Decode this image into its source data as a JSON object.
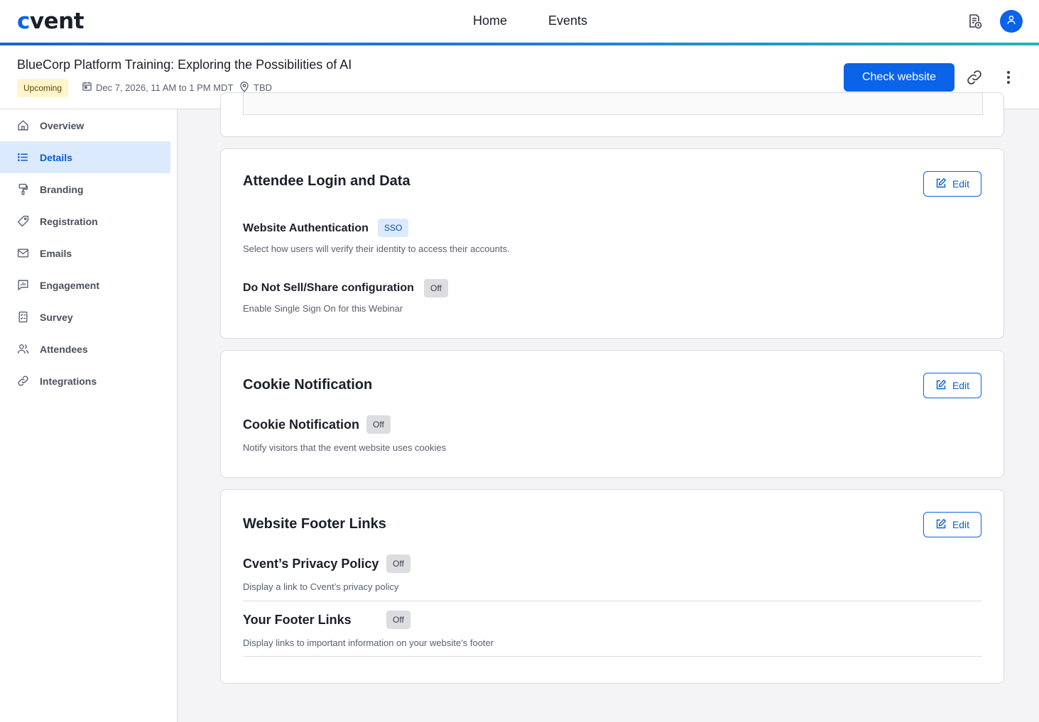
{
  "topbar": {
    "logo_c": "c",
    "logo_rest": "vent",
    "nav": [
      "Home",
      "Events"
    ],
    "icons": [
      "report-clock-icon",
      "user-icon"
    ]
  },
  "event": {
    "title": "BlueCorp Platform Training: Exploring the Possibilities of AI",
    "status": "Upcoming",
    "date": "Dec 7, 2026, 11 AM to 1 PM MDT",
    "location": "TBD",
    "check_website": "Check website"
  },
  "sidebar": {
    "items": [
      {
        "label": "Overview",
        "icon": "home-icon"
      },
      {
        "label": "Details",
        "icon": "list-icon"
      },
      {
        "label": "Branding",
        "icon": "paint-roller-icon"
      },
      {
        "label": "Registration",
        "icon": "tag-icon"
      },
      {
        "label": "Emails",
        "icon": "envelope-icon"
      },
      {
        "label": "Engagement",
        "icon": "chat-chart-icon"
      },
      {
        "label": "Survey",
        "icon": "checklist-icon"
      },
      {
        "label": "Attendees",
        "icon": "people-icon"
      },
      {
        "label": "Integrations",
        "icon": "link-icon"
      }
    ],
    "active": "Details"
  },
  "cards": {
    "login": {
      "title": "Attendee Login and Data",
      "edit": "Edit",
      "settings": [
        {
          "name": "Website Authentication",
          "badge": "SSO",
          "desc": "Select how users will verify their identity to access their accounts."
        },
        {
          "name": "Do Not Sell/Share configuration",
          "badge": "Off",
          "desc": "Enable Single Sign On for this Webinar"
        }
      ]
    },
    "cookie": {
      "title": "Cookie Notification",
      "edit": "Edit",
      "settings": [
        {
          "name": "Cookie Notification",
          "badge": "Off",
          "desc": "Notify visitors that the event website uses cookies"
        }
      ]
    },
    "footer": {
      "title": "Website Footer Links",
      "edit": "Edit",
      "settings": [
        {
          "name": "Cvent’s Privacy Policy",
          "badge": "Off",
          "desc": "Display a link to Cvent’s privacy policy"
        },
        {
          "name": "Your Footer Links",
          "badge": "Off",
          "desc": "Display links to important information on your website’s footer"
        }
      ]
    }
  },
  "colors": {
    "brand": "#0a63e8",
    "active_bg": "#dbeafc",
    "badge_upcoming": "#fff4cc"
  }
}
